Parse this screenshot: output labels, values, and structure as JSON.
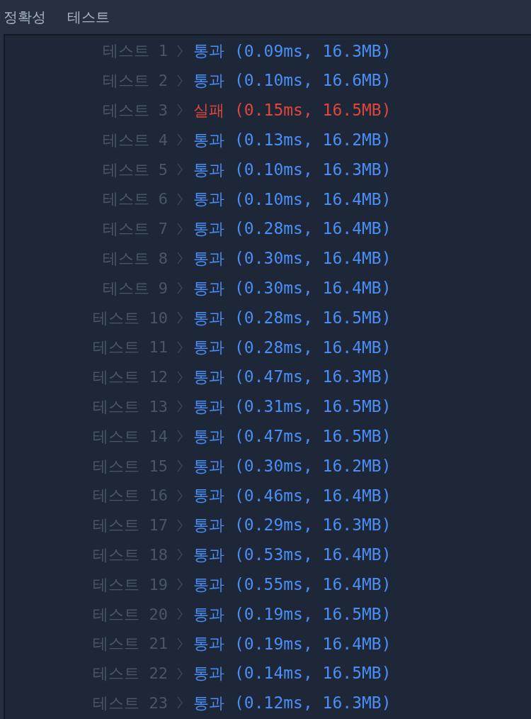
{
  "header": {
    "title": "정확성",
    "subtitle": "테스트"
  },
  "results": [
    {
      "label": "테스트 1",
      "kind": "pass",
      "result": "통과",
      "detail": "(0.09ms, 16.3MB)"
    },
    {
      "label": "테스트 2",
      "kind": "pass",
      "result": "통과",
      "detail": "(0.10ms, 16.6MB)"
    },
    {
      "label": "테스트 3",
      "kind": "fail",
      "result": "실패",
      "detail": "(0.15ms, 16.5MB)"
    },
    {
      "label": "테스트 4",
      "kind": "pass",
      "result": "통과",
      "detail": "(0.13ms, 16.2MB)"
    },
    {
      "label": "테스트 5",
      "kind": "pass",
      "result": "통과",
      "detail": "(0.10ms, 16.3MB)"
    },
    {
      "label": "테스트 6",
      "kind": "pass",
      "result": "통과",
      "detail": "(0.10ms, 16.4MB)"
    },
    {
      "label": "테스트 7",
      "kind": "pass",
      "result": "통과",
      "detail": "(0.28ms, 16.4MB)"
    },
    {
      "label": "테스트 8",
      "kind": "pass",
      "result": "통과",
      "detail": "(0.30ms, 16.4MB)"
    },
    {
      "label": "테스트 9",
      "kind": "pass",
      "result": "통과",
      "detail": "(0.30ms, 16.4MB)"
    },
    {
      "label": "테스트 10",
      "kind": "pass",
      "result": "통과",
      "detail": "(0.28ms, 16.5MB)"
    },
    {
      "label": "테스트 11",
      "kind": "pass",
      "result": "통과",
      "detail": "(0.28ms, 16.4MB)"
    },
    {
      "label": "테스트 12",
      "kind": "pass",
      "result": "통과",
      "detail": "(0.47ms, 16.3MB)"
    },
    {
      "label": "테스트 13",
      "kind": "pass",
      "result": "통과",
      "detail": "(0.31ms, 16.5MB)"
    },
    {
      "label": "테스트 14",
      "kind": "pass",
      "result": "통과",
      "detail": "(0.47ms, 16.5MB)"
    },
    {
      "label": "테스트 15",
      "kind": "pass",
      "result": "통과",
      "detail": "(0.30ms, 16.2MB)"
    },
    {
      "label": "테스트 16",
      "kind": "pass",
      "result": "통과",
      "detail": "(0.46ms, 16.4MB)"
    },
    {
      "label": "테스트 17",
      "kind": "pass",
      "result": "통과",
      "detail": "(0.29ms, 16.3MB)"
    },
    {
      "label": "테스트 18",
      "kind": "pass",
      "result": "통과",
      "detail": "(0.53ms, 16.4MB)"
    },
    {
      "label": "테스트 19",
      "kind": "pass",
      "result": "통과",
      "detail": "(0.55ms, 16.4MB)"
    },
    {
      "label": "테스트 20",
      "kind": "pass",
      "result": "통과",
      "detail": "(0.19ms, 16.5MB)"
    },
    {
      "label": "테스트 21",
      "kind": "pass",
      "result": "통과",
      "detail": "(0.19ms, 16.4MB)"
    },
    {
      "label": "테스트 22",
      "kind": "pass",
      "result": "통과",
      "detail": "(0.14ms, 16.5MB)"
    },
    {
      "label": "테스트 23",
      "kind": "pass",
      "result": "통과",
      "detail": "(0.12ms, 16.3MB)"
    }
  ]
}
